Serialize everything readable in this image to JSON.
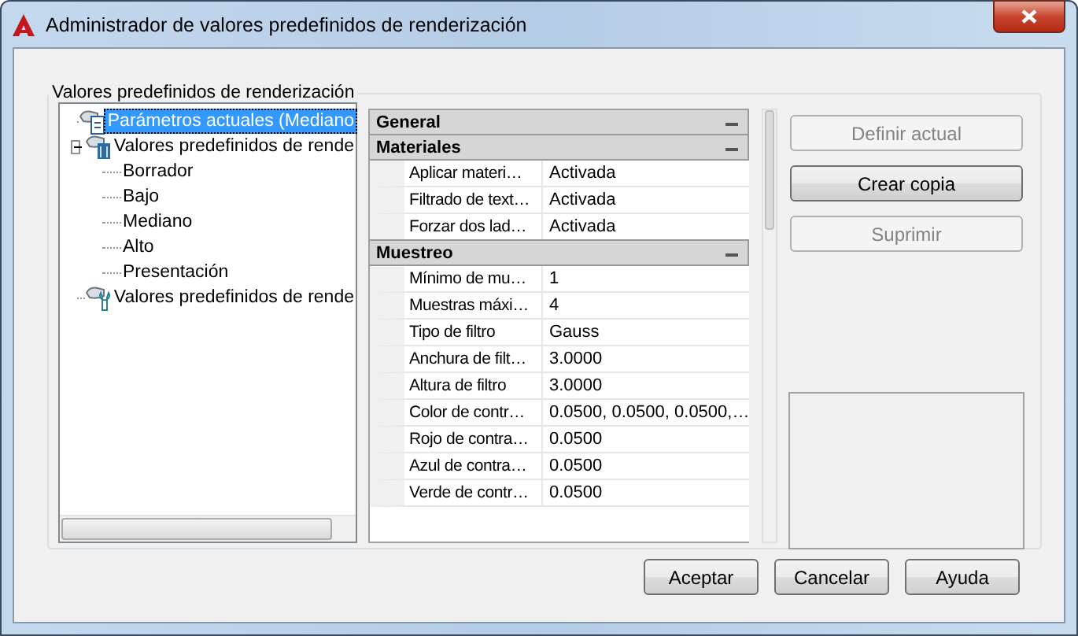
{
  "window": {
    "title": "Administrador de valores predefinidos de renderización"
  },
  "group_label": "Valores predefinidos de renderización",
  "tree": [
    {
      "label": "Parámetros actuales (Mediano",
      "kind": "current",
      "selected": true
    },
    {
      "label": "Valores predefinidos de rende",
      "kind": "standard",
      "selected": false,
      "expanded": true,
      "children": [
        {
          "label": "Borrador",
          "selected": false
        },
        {
          "label": "Bajo",
          "selected": false
        },
        {
          "label": "Mediano",
          "selected": false
        },
        {
          "label": "Alto",
          "selected": false
        },
        {
          "label": "Presentación",
          "selected": false
        }
      ]
    },
    {
      "label": "Valores predefinidos de rende",
      "kind": "custom",
      "selected": false
    }
  ],
  "properties": [
    {
      "category": "General",
      "expanded": true
    },
    {
      "category": "Materiales",
      "expanded": true,
      "rows": [
        {
          "name": "Aplicar materi…",
          "value": "Activada"
        },
        {
          "name": "Filtrado de text…",
          "value": "Activada"
        },
        {
          "name": "Forzar dos lad…",
          "value": "Activada"
        }
      ]
    },
    {
      "category": "Muestreo",
      "expanded": true,
      "rows": [
        {
          "name": "Mínimo de mu…",
          "value": "1"
        },
        {
          "name": "Muestras máxi…",
          "value": "4"
        },
        {
          "name": "Tipo de filtro",
          "value": "Gauss"
        },
        {
          "name": "Anchura de filt…",
          "value": "3.0000"
        },
        {
          "name": "Altura de filtro",
          "value": "3.0000"
        },
        {
          "name": "Color de contr…",
          "value": "0.0500, 0.0500, 0.0500,…"
        },
        {
          "name": "Rojo de contra…",
          "value": "0.0500"
        },
        {
          "name": "Azul de contra…",
          "value": "0.0500"
        },
        {
          "name": "Verde de contr…",
          "value": "0.0500"
        }
      ]
    }
  ],
  "side_buttons": [
    {
      "label": "Definir actual",
      "disabled": true
    },
    {
      "label": "Crear copia",
      "disabled": false
    },
    {
      "label": "Suprimir",
      "disabled": true
    }
  ],
  "footer_buttons": [
    {
      "label": "Aceptar"
    },
    {
      "label": "Cancelar"
    },
    {
      "label": "Ayuda"
    }
  ]
}
